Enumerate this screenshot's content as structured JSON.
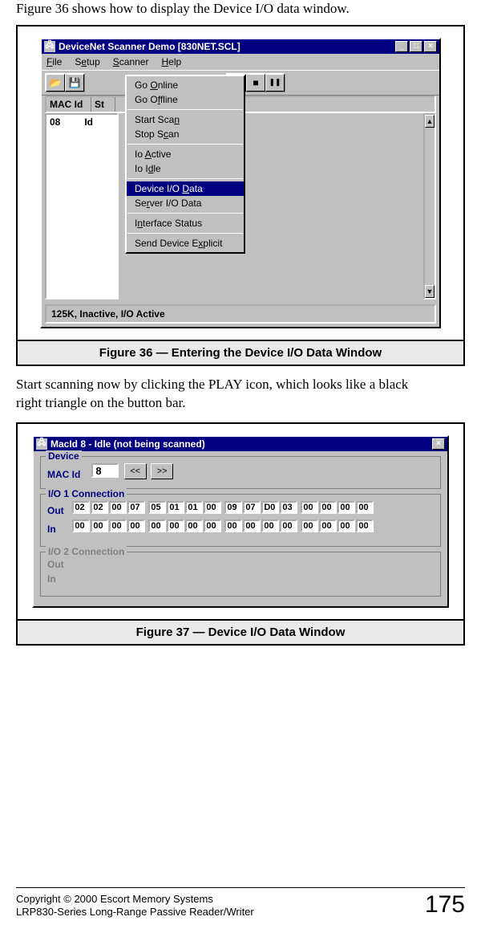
{
  "intro_text": "Figure 36 shows how to display the Device I/O data window.",
  "mid_text_1": "Start scanning now by clicking the PLAY icon, which looks like a black",
  "mid_text_2": "right triangle on the button bar.",
  "figure36": {
    "caption": "Figure 36 —  Entering the Device I/O Data Window",
    "title": "DeviceNet Scanner Demo [830NET.SCL]",
    "menus": {
      "file": "File",
      "setup": "Setup",
      "scanner": "Scanner",
      "help": "Help"
    },
    "dropdown": {
      "go_online": "Go Online",
      "go_offline": "Go Offline",
      "start_scan": "Start Scan",
      "stop_scan": "Stop Scan",
      "io_active": "Io Active",
      "io_idle": "Io Idle",
      "device_io": "Device I/O Data",
      "server_io": "Server I/O Data",
      "interface_status": "Interface Status",
      "send_explicit": "Send Device Explicit"
    },
    "table_head": {
      "mac": "MAC Id",
      "st": "St"
    },
    "row": {
      "mac": "08",
      "st": "Id"
    },
    "status": "125K, Inactive, I/O Active"
  },
  "figure37": {
    "caption": "Figure 37 — Device I/O Data Window",
    "title": "MacId 8 - Idle (not being scanned)",
    "device_legend": "Device",
    "macid_label": "MAC Id",
    "macid_value": "8",
    "nav_prev": "<<",
    "nav_next": ">>",
    "conn1_legend": "I/O 1 Connection",
    "conn2_legend": "I/O 2 Connection",
    "out_label": "Out",
    "in_label": "In",
    "out_values": [
      "02",
      "02",
      "00",
      "07",
      "05",
      "01",
      "01",
      "00",
      "09",
      "07",
      "D0",
      "03",
      "00",
      "00",
      "00",
      "00"
    ],
    "in_values": [
      "00",
      "00",
      "00",
      "00",
      "00",
      "00",
      "00",
      "00",
      "00",
      "00",
      "00",
      "00",
      "00",
      "00",
      "00",
      "00"
    ]
  },
  "footer": {
    "copyright": "Copyright © 2000 Escort Memory Systems",
    "product": "LRP830-Series Long-Range Passive Reader/Writer",
    "page": "175"
  },
  "icons": {
    "open": "📂",
    "save": "💾",
    "play": "▶",
    "stop": "■",
    "pause": "❚❚",
    "min": "_",
    "max": "□",
    "close": "×",
    "up": "▲",
    "down": "▼"
  }
}
